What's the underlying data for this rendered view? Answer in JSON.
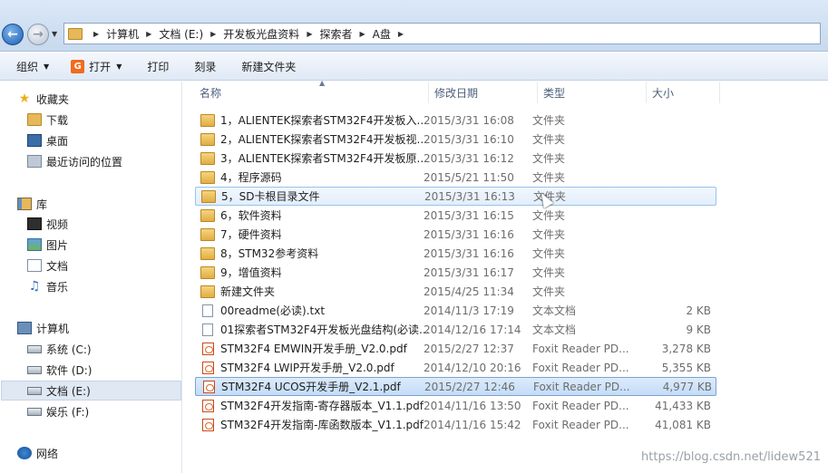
{
  "address": {
    "crumbs": [
      "计算机",
      "文档 (E:)",
      "开发板光盘资料",
      "探索者",
      "A盘"
    ]
  },
  "toolbar": {
    "organize": "组织",
    "open": "打开",
    "print": "打印",
    "burn": "刻录",
    "new_folder": "新建文件夹"
  },
  "nav": {
    "favorites": "收藏夹",
    "downloads": "下载",
    "desktop": "桌面",
    "recent": "最近访问的位置",
    "libraries": "库",
    "videos": "视频",
    "pictures": "图片",
    "documents": "文档",
    "music": "音乐",
    "computer": "计算机",
    "drive_c": "系统 (C:)",
    "drive_d": "软件 (D:)",
    "drive_e": "文档 (E:)",
    "drive_f": "娱乐 (F:)",
    "network": "网络"
  },
  "columns": {
    "name": "名称",
    "date": "修改日期",
    "type": "类型",
    "size": "大小"
  },
  "files": [
    {
      "name": "1，ALIENTEK探索者STM32F4开发板入...",
      "date": "2015/3/31 16:08",
      "type": "文件夹",
      "size": "",
      "icon": "folder-icon"
    },
    {
      "name": "2，ALIENTEK探索者STM32F4开发板视...",
      "date": "2015/3/31 16:10",
      "type": "文件夹",
      "size": "",
      "icon": "folder-icon"
    },
    {
      "name": "3，ALIENTEK探索者STM32F4开发板原...",
      "date": "2015/3/31 16:12",
      "type": "文件夹",
      "size": "",
      "icon": "folder-icon"
    },
    {
      "name": "4，程序源码",
      "date": "2015/5/21 11:50",
      "type": "文件夹",
      "size": "",
      "icon": "folder-icon"
    },
    {
      "name": "5，SD卡根目录文件",
      "date": "2015/3/31 16:13",
      "type": "文件夹",
      "size": "",
      "icon": "folder-icon"
    },
    {
      "name": "6，软件资料",
      "date": "2015/3/31 16:15",
      "type": "文件夹",
      "size": "",
      "icon": "folder-icon"
    },
    {
      "name": "7，硬件资料",
      "date": "2015/3/31 16:16",
      "type": "文件夹",
      "size": "",
      "icon": "folder-icon"
    },
    {
      "name": "8，STM32参考资料",
      "date": "2015/3/31 16:16",
      "type": "文件夹",
      "size": "",
      "icon": "folder-icon"
    },
    {
      "name": "9，增值资料",
      "date": "2015/3/31 16:17",
      "type": "文件夹",
      "size": "",
      "icon": "folder-icon"
    },
    {
      "name": "新建文件夹",
      "date": "2015/4/25 11:34",
      "type": "文件夹",
      "size": "",
      "icon": "folder-icon"
    },
    {
      "name": "00readme(必读).txt",
      "date": "2014/11/3 17:19",
      "type": "文本文档",
      "size": "2 KB",
      "icon": "text-file-icon"
    },
    {
      "name": "01探索者STM32F4开发板光盘结构(必读...",
      "date": "2014/12/16 17:14",
      "type": "文本文档",
      "size": "9 KB",
      "icon": "text-file-icon"
    },
    {
      "name": "STM32F4 EMWIN开发手册_V2.0.pdf",
      "date": "2015/2/27 12:37",
      "type": "Foxit Reader PD...",
      "size": "3,278 KB",
      "icon": "pdf-file-icon"
    },
    {
      "name": "STM32F4 LWIP开发手册_V2.0.pdf",
      "date": "2014/12/10 20:16",
      "type": "Foxit Reader PD...",
      "size": "5,355 KB",
      "icon": "pdf-file-icon"
    },
    {
      "name": "STM32F4 UCOS开发手册_V2.1.pdf",
      "date": "2015/2/27 12:46",
      "type": "Foxit Reader PD...",
      "size": "4,977 KB",
      "icon": "pdf-file-icon"
    },
    {
      "name": "STM32F4开发指南-寄存器版本_V1.1.pdf",
      "date": "2014/11/16 13:50",
      "type": "Foxit Reader PD...",
      "size": "41,433 KB",
      "icon": "pdf-file-icon"
    },
    {
      "name": "STM32F4开发指南-库函数版本_V1.1.pdf",
      "date": "2014/11/16 15:42",
      "type": "Foxit Reader PD...",
      "size": "41,081 KB",
      "icon": "pdf-file-icon"
    }
  ],
  "watermark": "https://blog.csdn.net/lidew521"
}
